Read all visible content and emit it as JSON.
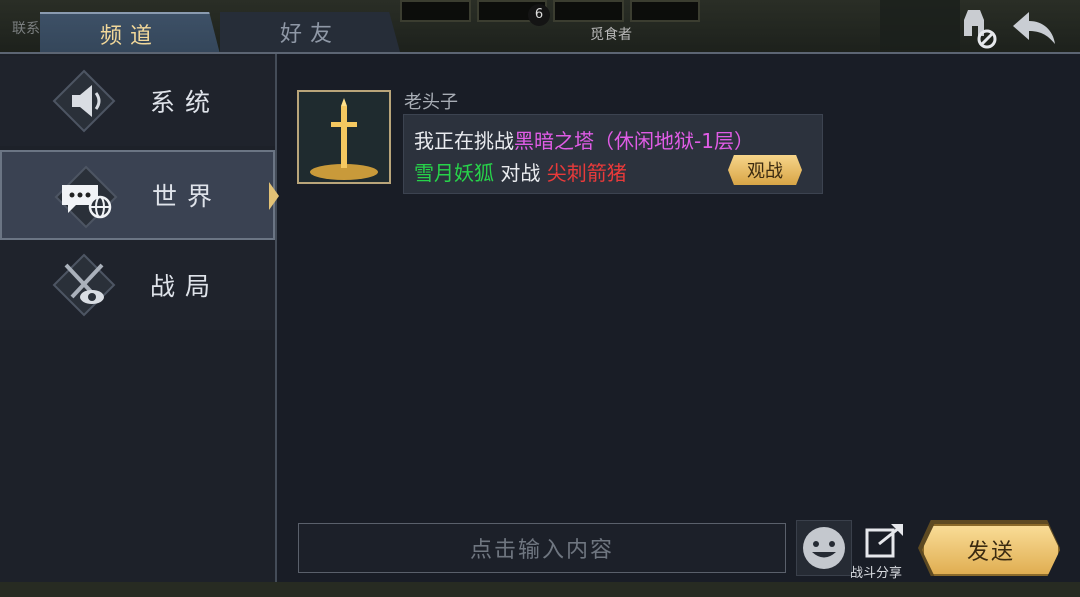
{
  "background": {
    "left_text": "联系",
    "badge": "6",
    "player_name": "觅食者"
  },
  "tabs": [
    {
      "label": "频道",
      "active": true
    },
    {
      "label": "好友",
      "active": false
    }
  ],
  "top_icons": [
    "helmet-mute-icon",
    "back-arrow-icon"
  ],
  "sidebar": {
    "items": [
      {
        "label": "系统",
        "icon": "megaphone-icon",
        "active": false
      },
      {
        "label": "世界",
        "icon": "world-chat-icon",
        "active": true
      },
      {
        "label": "战局",
        "icon": "crossed-swords-eye-icon",
        "active": false
      }
    ]
  },
  "chat": {
    "messages": [
      {
        "sender": "老头子",
        "avatar": "sword-avatar",
        "line1_prefix": "我正在挑战",
        "line1_highlight": "黑暗之塔（休闲地狱-1层）",
        "player1": "雪月妖狐",
        "versus": " 对战 ",
        "player2": "尖刺箭猪",
        "watch_label": "观战"
      }
    ]
  },
  "input": {
    "placeholder": "点击输入内容"
  },
  "share_label": "战斗分享",
  "send_label": "发送",
  "colors": {
    "highlight_purple": "#e05ce6",
    "player_green": "#27d34a",
    "player_red": "#e83a3a",
    "gold_button": "#e0ae52"
  }
}
